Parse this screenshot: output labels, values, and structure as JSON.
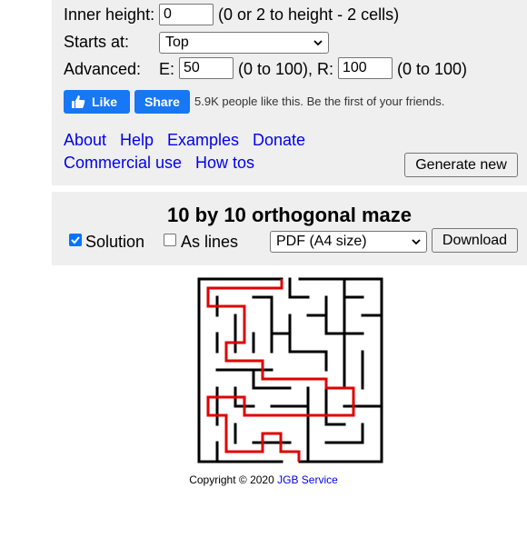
{
  "form": {
    "inner_height": {
      "label": "Inner height:",
      "value": "0",
      "hint": "(0 or 2 to height - 2 cells)"
    },
    "starts_at": {
      "label": "Starts at:",
      "value": "Top"
    },
    "advanced": {
      "label": "Advanced:",
      "e_label": "E:",
      "e_value": "50",
      "e_hint": "(0 to 100), R:",
      "r_value": "100",
      "r_hint": "(0 to 100)"
    }
  },
  "facebook": {
    "like_label": "Like",
    "share_label": "Share",
    "text": "5.9K people like this. Be the first of your friends."
  },
  "links": {
    "about": "About",
    "help": "Help",
    "examples": "Examples",
    "donate": "Donate",
    "commercial": "Commercial use",
    "howtos": "How tos"
  },
  "generate_label": "Generate new",
  "maze_panel": {
    "title": "10 by 10 orthogonal maze",
    "solution_label": "Solution",
    "solution_checked": true,
    "as_lines_label": "As lines",
    "as_lines_checked": false,
    "format_value": "PDF (A4 size)",
    "download_label": "Download"
  },
  "copyright": {
    "prefix": "Copyright © 2020",
    "link": "JGB Service"
  },
  "colors": {
    "accent": "#0075ff",
    "facebook": "#1877f2",
    "link": "#0000ee",
    "solution": "#e00000",
    "panel": "#efefef"
  }
}
